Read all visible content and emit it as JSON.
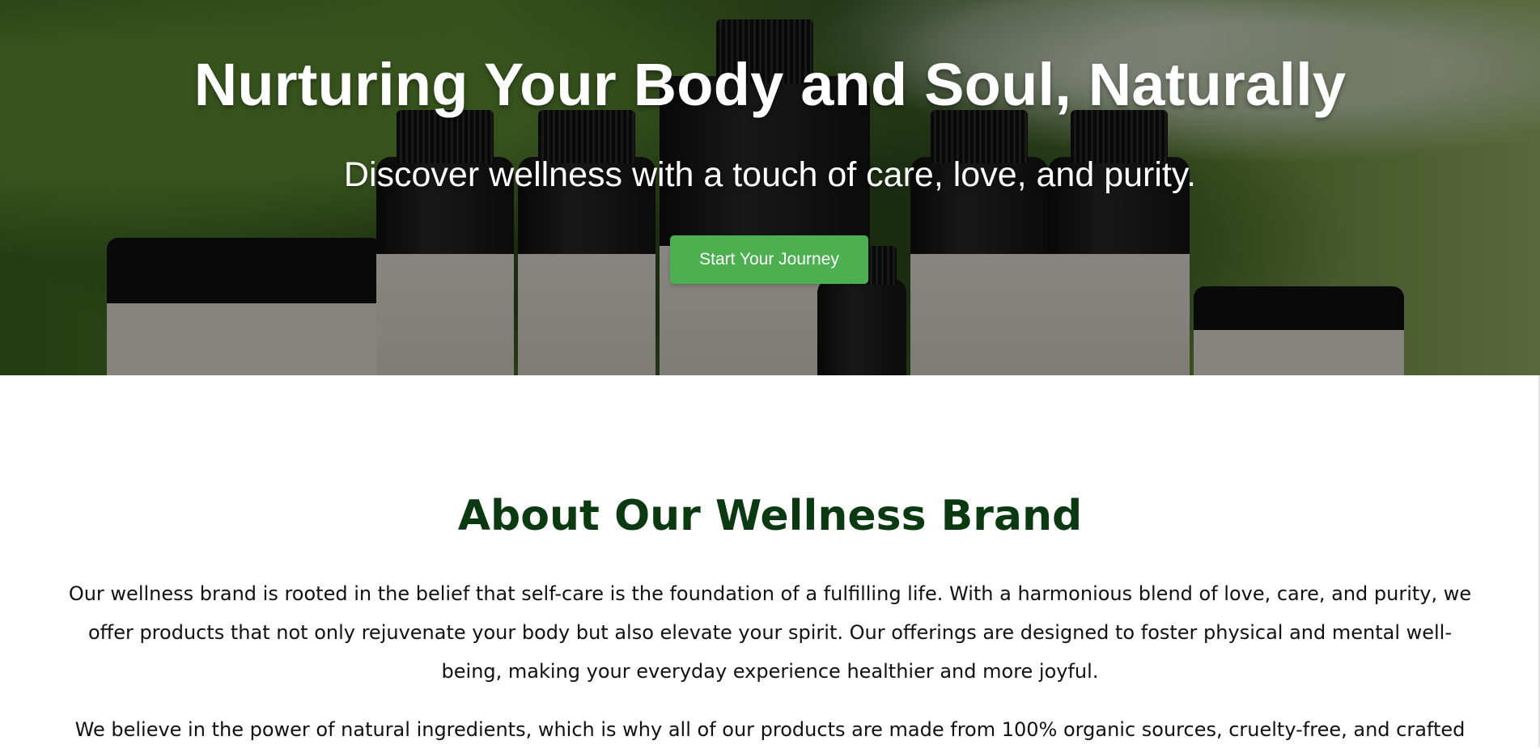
{
  "hero": {
    "title": "Nurturing Your Body and Soul, Naturally",
    "subtitle": "Discover wellness with a touch of care, love, and purity.",
    "cta_label": "Start Your Journey",
    "background_image": "skincare-products-photo",
    "cta_color": "#4caf50"
  },
  "about": {
    "title": "About Our Wellness Brand",
    "title_color": "#0b3a12",
    "paragraphs": [
      "Our wellness brand is rooted in the belief that self-care is the foundation of a fulfilling life. With a harmonious blend of love, care, and purity, we offer products that not only rejuvenate your body but also elevate your spirit. Our offerings are designed to foster physical and mental well-being, making your everyday experience healthier and more joyful.",
      "We believe in the power of natural ingredients, which is why all of our products are made from 100% organic sources, cruelty-free, and crafted"
    ]
  }
}
